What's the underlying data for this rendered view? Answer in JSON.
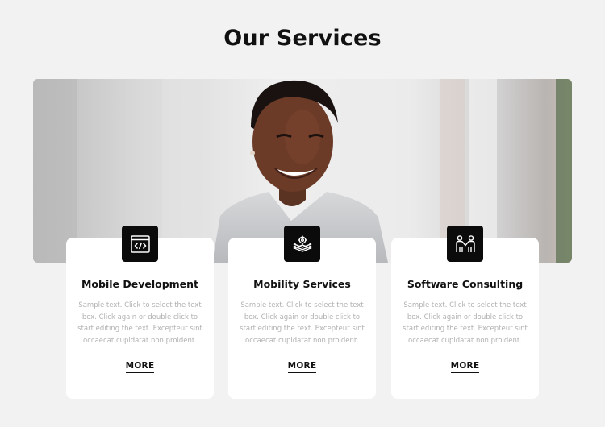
{
  "header": {
    "title": "Our Services"
  },
  "hero": {
    "image": "smiling-woman-in-gray-blazer-photo"
  },
  "cards": [
    {
      "icon": "code-window-icon",
      "title": "Mobile Development",
      "text": "Sample text. Click to select the text box. Click again or double click to start editing the text. Excepteur sint occaecat cupidatat non proident.",
      "link": "MORE"
    },
    {
      "icon": "layers-settings-icon",
      "title": "Mobility Services",
      "text": "Sample text. Click to select the text box. Click again or double click to start editing the text. Excepteur sint occaecat cupidatat non proident.",
      "link": "MORE"
    },
    {
      "icon": "consulting-people-icon",
      "title": "Software Consulting",
      "text": "Sample text. Click to select the text box. Click again or double click to start editing the text. Excepteur sint occaecat cupidatat non proident.",
      "link": "MORE"
    }
  ],
  "colors": {
    "background": "#f2f2f3",
    "card": "#ffffff",
    "icon_tile": "#0b0b0b",
    "heading": "#111111",
    "body_text": "#b1b1b1"
  }
}
